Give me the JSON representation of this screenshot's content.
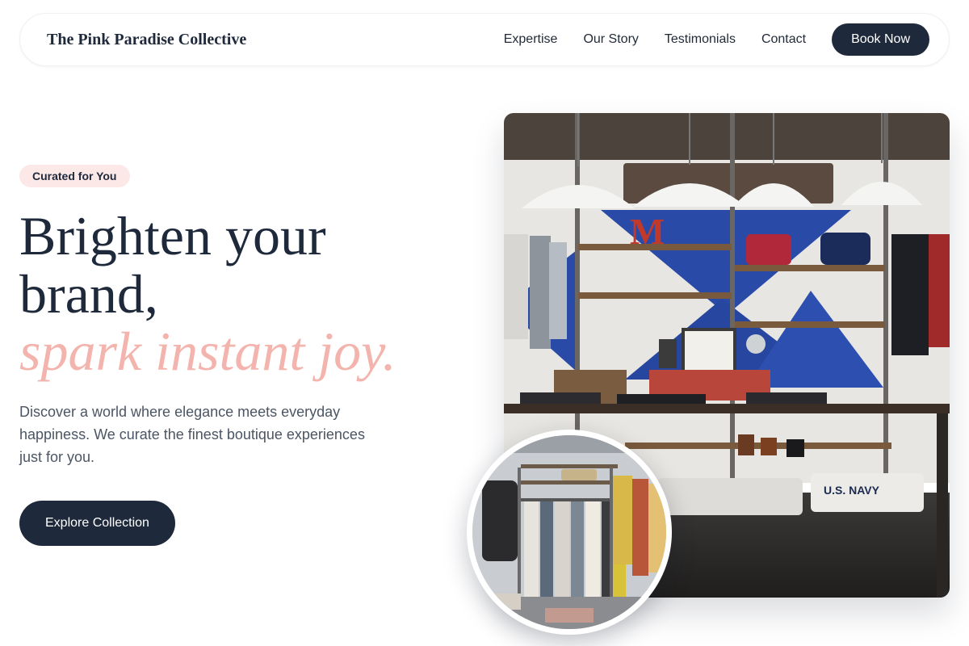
{
  "header": {
    "logo": "The Pink Paradise Collective",
    "nav": [
      "Expertise",
      "Our Story",
      "Testimonials",
      "Contact"
    ],
    "cta": "Book Now"
  },
  "hero": {
    "badge": "Curated for You",
    "headline_line1": "Brighten your",
    "headline_line2": "brand,",
    "headline_accent": "spark instant joy.",
    "description": "Discover a world where elegance meets everyday happiness. We curate the finest boutique experiences just for you.",
    "cta": "Explore Collection"
  },
  "images": {
    "main": {
      "subject": "boutique-store-interior",
      "sign_text": "U.S. NAVY"
    },
    "secondary": {
      "subject": "clothing-rack-dresses"
    }
  },
  "colors": {
    "primary": "#1e293b",
    "accent": "#f4b4ae",
    "badge_bg": "#fde8e8",
    "body_text": "#4b5563"
  }
}
